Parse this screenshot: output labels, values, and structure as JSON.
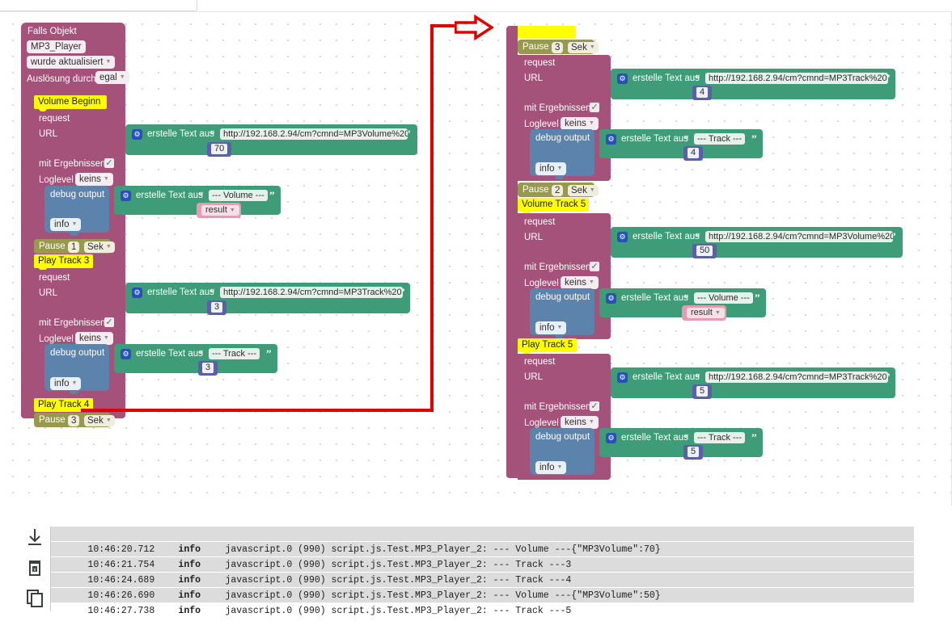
{
  "app": {
    "canvas_label": "blockly-canvas"
  },
  "left_script": {
    "hat": {
      "title": "Falls Objekt",
      "object_field": "MP3_Player",
      "event_field": "wurde aktualisiert",
      "trigger_label": "Auslösung durch",
      "trigger_field": "egal"
    },
    "comment1": "Volume Beginn",
    "request1": {
      "title": "request",
      "url_label": "URL",
      "text_builder": "erstelle Text aus",
      "url_value": "http://192.168.2.94/cm?cmnd=MP3Volume%20",
      "number_value": "70",
      "with_results_label": "mit Ergebnissen",
      "with_results_checked": "✓",
      "loglevel_label": "Loglevel",
      "loglevel_field": "keins",
      "debug_label": "debug output",
      "debug_text_builder": "erstelle Text aus",
      "debug_text_value": "--- Volume ---",
      "debug_var": "result",
      "debug_severity": "info"
    },
    "pause1": {
      "label": "Pause",
      "value": "1",
      "unit": "Sek"
    },
    "comment2": "Play Track 3",
    "request2": {
      "title": "request",
      "url_label": "URL",
      "text_builder": "erstelle Text aus",
      "url_value": "http://192.168.2.94/cm?cmnd=MP3Track%20",
      "number_value": "3",
      "with_results_label": "mit Ergebnissen",
      "with_results_checked": "✓",
      "loglevel_label": "Loglevel",
      "loglevel_field": "keins",
      "debug_label": "debug output",
      "debug_text_builder": "erstelle Text aus",
      "debug_text_value": "--- Track ---",
      "debug_number": "3",
      "debug_severity": "info"
    },
    "comment3": "Play Track 4",
    "pause2": {
      "label": "Pause",
      "value": "3",
      "unit": "Sek"
    }
  },
  "right_script": {
    "pause1": {
      "label": "Pause",
      "value": "3",
      "unit": "Sek"
    },
    "request1": {
      "title": "request",
      "url_label": "URL",
      "text_builder": "erstelle Text aus",
      "url_value": "http://192.168.2.94/cm?cmnd=MP3Track%20",
      "number_value": "4",
      "with_results_label": "mit Ergebnissen",
      "with_results_checked": "✓",
      "loglevel_label": "Loglevel",
      "loglevel_field": "keins",
      "debug_label": "debug output",
      "debug_text_builder": "erstelle Text aus",
      "debug_text_value": "--- Track ---",
      "debug_number": "4",
      "debug_severity": "info"
    },
    "pause2": {
      "label": "Pause",
      "value": "2",
      "unit": "Sek"
    },
    "comment1": "Volume Track 5",
    "request2": {
      "title": "request",
      "url_label": "URL",
      "text_builder": "erstelle Text aus",
      "url_value": "http://192.168.2.94/cm?cmnd=MP3Volume%20",
      "number_value": "50",
      "with_results_label": "mit Ergebnissen",
      "with_results_checked": "✓",
      "loglevel_label": "Loglevel",
      "loglevel_field": "keins",
      "debug_label": "debug output",
      "debug_text_builder": "erstelle Text aus",
      "debug_text_value": "--- Volume ---",
      "debug_var": "result",
      "debug_severity": "info"
    },
    "comment2": "Play Track 5",
    "request3": {
      "title": "request",
      "url_label": "URL",
      "text_builder": "erstelle Text aus",
      "url_value": "http://192.168.2.94/cm?cmnd=MP3Track%20",
      "number_value": "5",
      "with_results_label": "mit Ergebnissen",
      "with_results_checked": "✓",
      "loglevel_label": "Loglevel",
      "loglevel_field": "keins",
      "debug_label": "debug output",
      "debug_text_builder": "erstelle Text aus",
      "debug_text_value": "--- Track ---",
      "debug_number": "5",
      "debug_severity": "info"
    }
  },
  "annotation": {
    "color": "#e00000",
    "arrow_icon": "right-arrow-icon"
  },
  "log": {
    "toolbar_icons": [
      "download-icon",
      "delete-log-icon",
      "copy-icon"
    ],
    "rows": [
      {
        "time": "10:46:20.712",
        "severity": "info",
        "message": "javascript.0 (990) script.js.Test.MP3_Player_2: --- Volume ---{\"MP3Volume\":70}"
      },
      {
        "time": "10:46:21.754",
        "severity": "info",
        "message": "javascript.0 (990) script.js.Test.MP3_Player_2: --- Track ---3"
      },
      {
        "time": "10:46:24.689",
        "severity": "info",
        "message": "javascript.0 (990) script.js.Test.MP3_Player_2: --- Track ---4"
      },
      {
        "time": "10:46:26.690",
        "severity": "info",
        "message": "javascript.0 (990) script.js.Test.MP3_Player_2: --- Volume ---{\"MP3Volume\":50}"
      },
      {
        "time": "10:46:27.738",
        "severity": "info",
        "message": "javascript.0 (990) script.js.Test.MP3_Player_2: --- Track ---5"
      }
    ]
  },
  "colors": {
    "magenta": "#a5527a",
    "green": "#3f9c78",
    "blue": "#5b83ab",
    "olive": "#98994e",
    "yellow": "#ffff00",
    "pink": "#e89ab4",
    "accent_red": "#e00000"
  }
}
